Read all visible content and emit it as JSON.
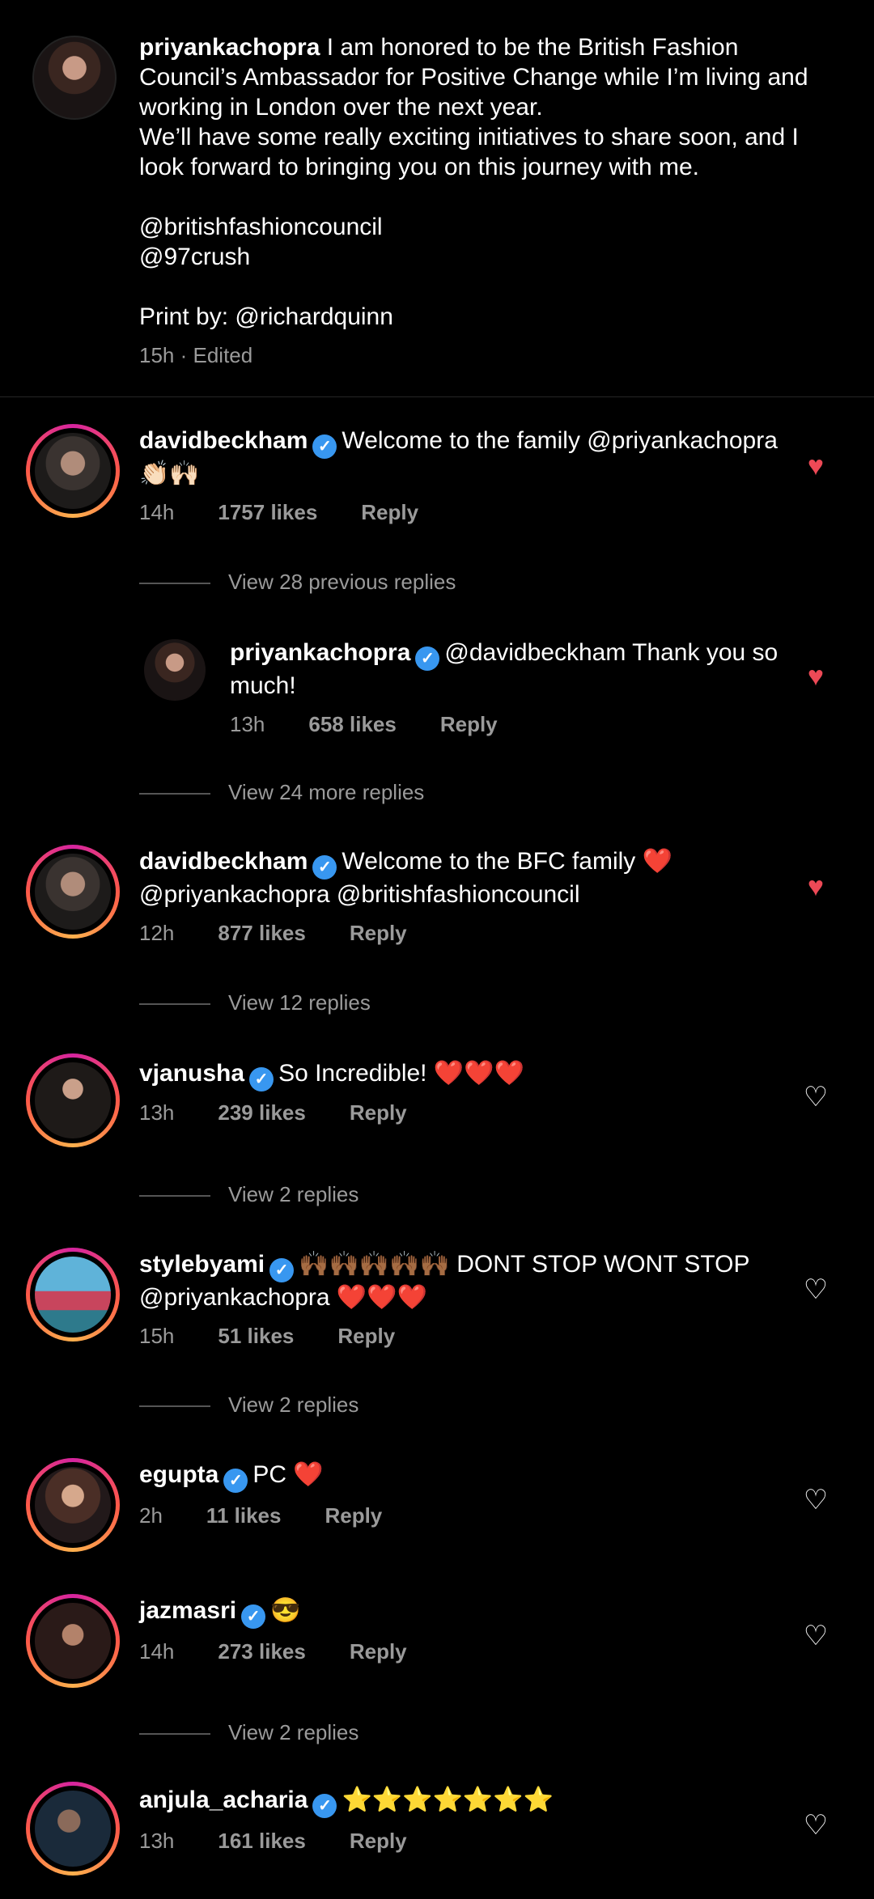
{
  "caption": {
    "username": "priyankachopra",
    "text": " I am honored to be the British Fashion Council’s Ambassador for Positive Change while I’m living and working in London over the next year.\nWe’ll have some really exciting initiatives to share soon, and I look forward to bringing you on this journey with me.\n\n@britishfashioncouncil\n@97crush\n\nPrint by: @richardquinn",
    "meta": "15h · Edited"
  },
  "comments": [
    {
      "username": "davidbeckham",
      "text": "Welcome to the family @priyankachopra 👏🏻🙌🏻",
      "time": "14h",
      "likes": "1757 likes",
      "reply": "Reply",
      "liked": true,
      "view_replies": "View 28 previous replies"
    },
    {
      "username": "priyankachopra",
      "text": "@davidbeckham Thank you so much!",
      "time": "13h",
      "likes": "658 likes",
      "reply": "Reply",
      "liked": true,
      "view_replies": "View 24 more replies"
    },
    {
      "username": "davidbeckham",
      "text": "Welcome to the BFC family ❤️ @priyankachopra @britishfashioncouncil",
      "time": "12h",
      "likes": "877 likes",
      "reply": "Reply",
      "liked": true,
      "view_replies": "View 12 replies"
    },
    {
      "username": "vjanusha",
      "text": "So Incredible! ❤️❤️❤️",
      "time": "13h",
      "likes": "239 likes",
      "reply": "Reply",
      "liked": false,
      "view_replies": "View 2 replies"
    },
    {
      "username": "stylebyami",
      "text": "🙌🏾🙌🏾🙌🏾🙌🏾🙌🏾 DONT STOP WONT STOP @priyankachopra ❤️❤️❤️",
      "time": "15h",
      "likes": "51 likes",
      "reply": "Reply",
      "liked": false,
      "view_replies": "View 2 replies"
    },
    {
      "username": "egupta",
      "text": "PC ❤️",
      "time": "2h",
      "likes": "11 likes",
      "reply": "Reply",
      "liked": false
    },
    {
      "username": "jazmasri",
      "text": "😎",
      "time": "14h",
      "likes": "273 likes",
      "reply": "Reply",
      "liked": false,
      "view_replies": "View 2 replies"
    },
    {
      "username": "anjula_acharia",
      "text": "⭐⭐⭐⭐⭐⭐⭐",
      "time": "13h",
      "likes": "161 likes",
      "reply": "Reply",
      "liked": false
    }
  ],
  "icons": {
    "verified": "verified-badge-icon",
    "heart_liked": "heart-filled-icon",
    "heart_unliked": "heart-outline-icon"
  },
  "colors": {
    "liked_heart": "#ed4956",
    "verified": "#3897f0",
    "secondary_text": "#9a9a9a"
  }
}
